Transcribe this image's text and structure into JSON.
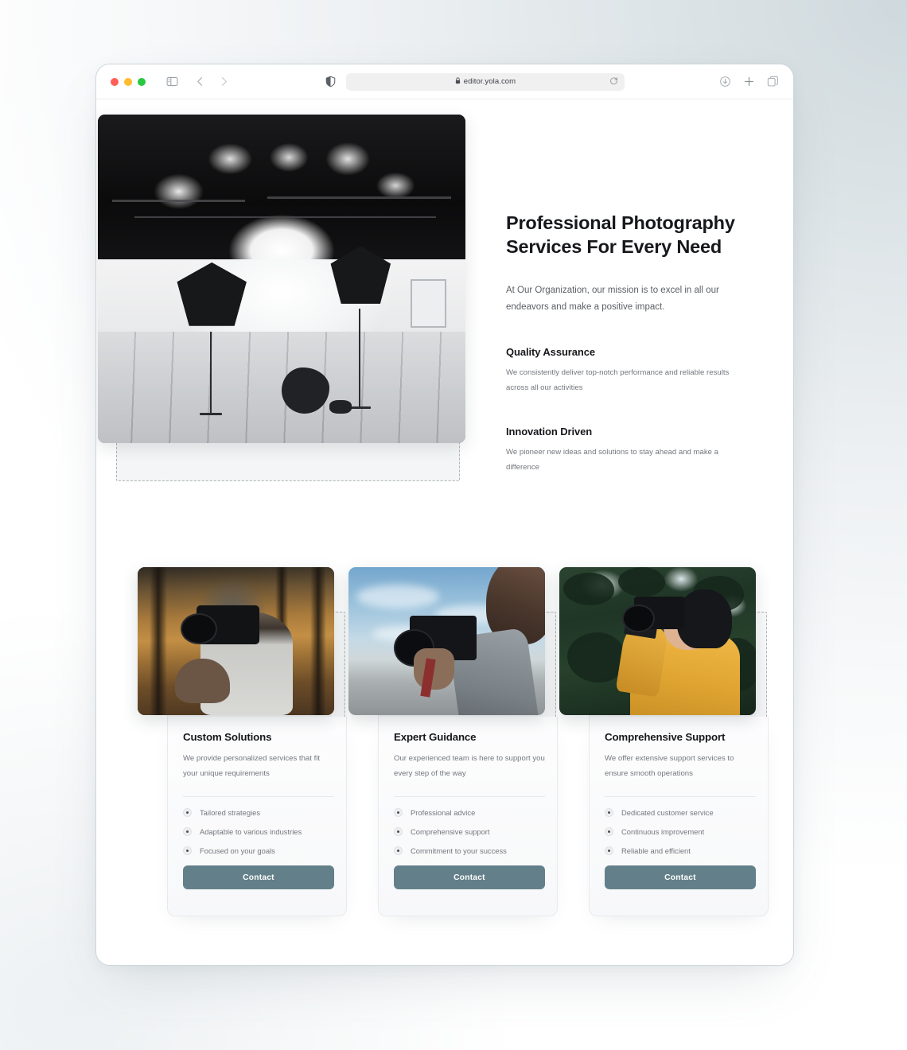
{
  "browser": {
    "traffic_lights": [
      "#ff5f57",
      "#febc2e",
      "#28c840"
    ],
    "sidebar_icon": "sidebar-toggle-icon",
    "back_icon": "back-chevron-icon",
    "forward_icon": "forward-chevron-icon",
    "shield_icon": "privacy-shield-icon",
    "lock_glyph": "🔒",
    "url": "editor.yola.com",
    "reload_icon": "reload-icon",
    "download_icon": "download-icon",
    "new_tab_icon": "plus-icon",
    "tab_overview_icon": "tab-overview-icon"
  },
  "hero": {
    "image_alt": "photography-studio-lighting",
    "title": "Professional Photography Services For Every Need",
    "subtitle": "At Our Organization, our mission is to excel in all our endeavors and make a positive impact.",
    "features": [
      {
        "heading": "Quality Assurance",
        "text": "We consistently deliver top-notch performance and reliable results across all our activities"
      },
      {
        "heading": "Innovation Driven",
        "text": "We pioneer new ideas and solutions to stay ahead and make a difference"
      }
    ]
  },
  "cards": [
    {
      "image_alt": "photographer-tossing-camera-in-autumn-forest",
      "title": "Custom Solutions",
      "description": "We provide personalized services that fit your unique requirements",
      "bullets": [
        "Tailored strategies",
        "Adaptable to various industries",
        "Focused on your goals"
      ],
      "button": "Contact"
    },
    {
      "image_alt": "photographer-holding-camera-against-sky",
      "title": "Expert Guidance",
      "description": "Our experienced team is here to support you every step of the way",
      "bullets": [
        "Professional advice",
        "Comprehensive support",
        "Commitment to your success"
      ],
      "button": "Contact"
    },
    {
      "image_alt": "woman-photographing-in-green-forest",
      "title": "Comprehensive Support",
      "description": "We offer extensive support services to ensure smooth operations",
      "bullets": [
        "Dedicated customer service",
        "Continuous improvement",
        "Reliable and efficient"
      ],
      "button": "Contact"
    }
  ],
  "colors": {
    "accent_button": "#63808a",
    "heading": "#16181b",
    "body_text": "#73777d",
    "selection_dash": "#adb3b7",
    "page_background": "#ffffff"
  }
}
